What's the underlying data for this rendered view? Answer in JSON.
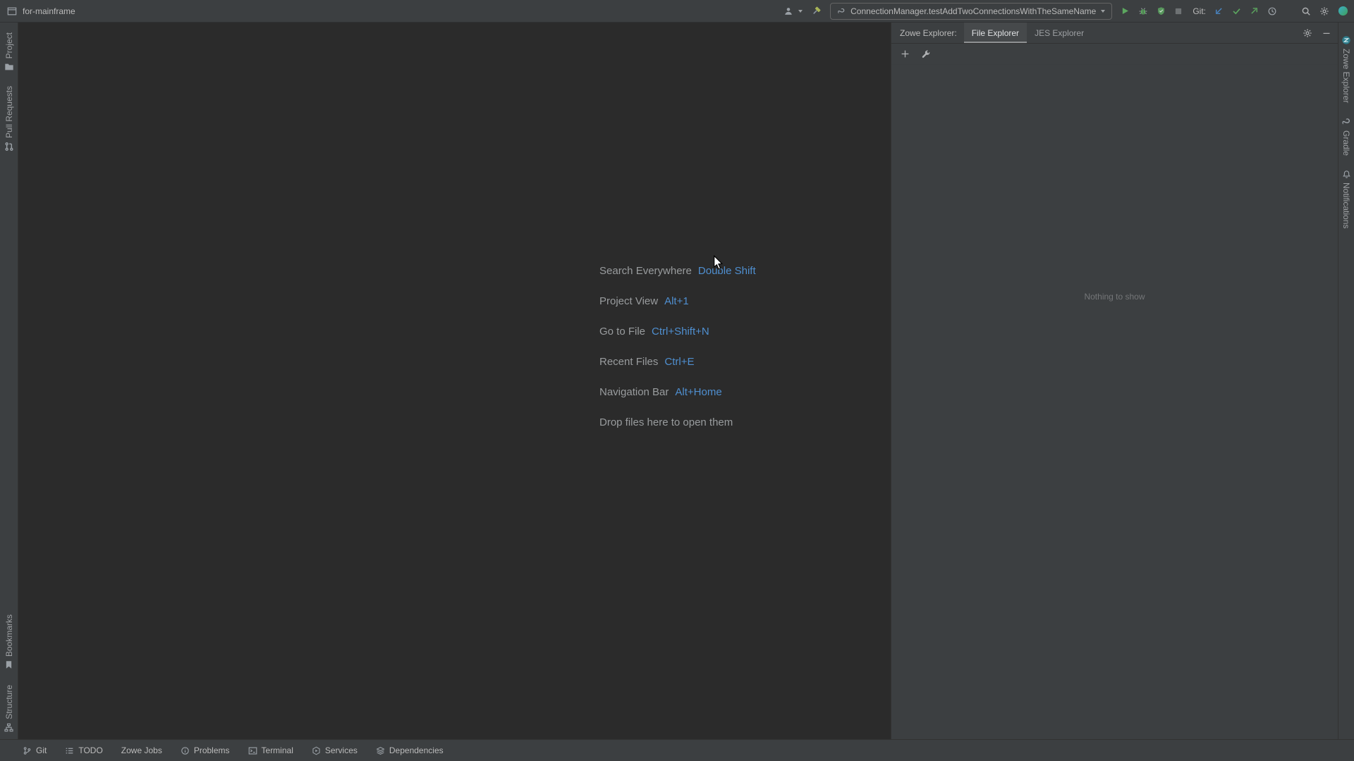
{
  "titlebar": {
    "project_name": "for-mainframe",
    "run_config": {
      "label": "ConnectionManager.testAddTwoConnectionsWithTheSameName",
      "icon": "run-configuration-icon"
    },
    "git_label": "Git:",
    "icons": [
      "app-icon",
      "user-dropdown-icon",
      "build-hammer-icon",
      "run-icon",
      "debug-icon",
      "coverage-icon",
      "stop-icon",
      "update-project-icon",
      "commit-icon",
      "push-icon",
      "history-icon",
      "search-everywhere-icon",
      "settings-gear-icon",
      "avatar-icon"
    ]
  },
  "left_stripe": {
    "top": [
      {
        "label": "Project",
        "icon": "project-folder-icon"
      },
      {
        "label": "Pull Requests",
        "icon": "pull-requests-icon"
      }
    ],
    "bottom": [
      {
        "label": "Bookmarks",
        "icon": "bookmarks-icon"
      },
      {
        "label": "Structure",
        "icon": "structure-icon"
      }
    ]
  },
  "right_stripe": {
    "items": [
      {
        "label": "Zowe Explorer",
        "icon": "zowe-explorer-icon"
      },
      {
        "label": "Gradle",
        "icon": "gradle-icon"
      },
      {
        "label": "Notifications",
        "icon": "notifications-bell-icon"
      }
    ]
  },
  "editor": {
    "hints": [
      {
        "action": "Search Everywhere",
        "shortcut": "Double Shift"
      },
      {
        "action": "Project View",
        "shortcut": "Alt+1"
      },
      {
        "action": "Go to File",
        "shortcut": "Ctrl+Shift+N"
      },
      {
        "action": "Recent Files",
        "shortcut": "Ctrl+E"
      },
      {
        "action": "Navigation Bar",
        "shortcut": "Alt+Home"
      }
    ],
    "drop_hint": "Drop files here to open them"
  },
  "zowe_panel": {
    "title": "Zowe Explorer:",
    "tabs": [
      {
        "label": "File Explorer",
        "selected": true
      },
      {
        "label": "JES Explorer",
        "selected": false
      }
    ],
    "toolbar_icons": [
      "add-profile-icon",
      "settings-wrench-icon"
    ],
    "header_icons": [
      "gear-icon",
      "hide-icon"
    ],
    "empty_text": "Nothing to show"
  },
  "bottom_bar": {
    "items": [
      {
        "label": "Git",
        "icon": "git-branch-icon"
      },
      {
        "label": "TODO",
        "icon": "todo-list-icon"
      },
      {
        "label": "Zowe Jobs",
        "icon": ""
      },
      {
        "label": "Problems",
        "icon": "problems-icon"
      },
      {
        "label": "Terminal",
        "icon": "terminal-icon"
      },
      {
        "label": "Services",
        "icon": "services-icon"
      },
      {
        "label": "Dependencies",
        "icon": "dependencies-icon"
      }
    ]
  },
  "colors": {
    "titlebar_bg": "#3c3f41",
    "editor_bg": "#2b2b2b",
    "panel_bg": "#3c3f41",
    "border": "#323232",
    "text": "#bbbbbb",
    "dim_text": "#9da0a3",
    "hint_gray": "#999c9e",
    "shortcut_blue": "#4f8fd0",
    "run_green": "#5ca75f",
    "vcs_update_blue": "#4a88c7"
  }
}
